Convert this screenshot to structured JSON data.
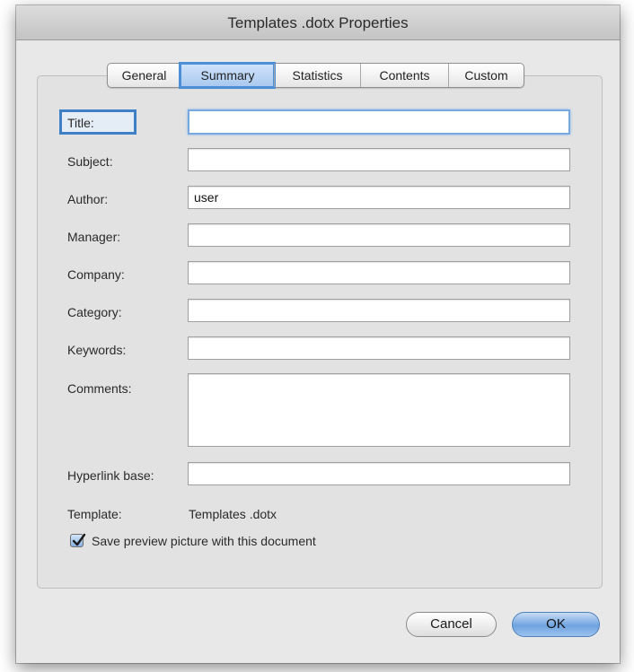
{
  "window": {
    "title": "Templates .dotx Properties"
  },
  "tabs": [
    {
      "label": "General"
    },
    {
      "label": "Summary"
    },
    {
      "label": "Statistics"
    },
    {
      "label": "Contents"
    },
    {
      "label": "Custom"
    }
  ],
  "active_tab": "Summary",
  "fields": {
    "title": {
      "label": "Title:",
      "value": ""
    },
    "subject": {
      "label": "Subject:",
      "value": ""
    },
    "author": {
      "label": "Author:",
      "value": "user"
    },
    "manager": {
      "label": "Manager:",
      "value": ""
    },
    "company": {
      "label": "Company:",
      "value": ""
    },
    "category": {
      "label": "Category:",
      "value": ""
    },
    "keywords": {
      "label": "Keywords:",
      "value": ""
    },
    "comments": {
      "label": "Comments:",
      "value": ""
    },
    "hyperlink_base": {
      "label": "Hyperlink base:",
      "value": ""
    }
  },
  "template": {
    "label": "Template:",
    "value": "Templates .dotx"
  },
  "save_preview": {
    "label": "Save preview picture with this document",
    "checked": true
  },
  "buttons": {
    "cancel": "Cancel",
    "ok": "OK"
  },
  "colors": {
    "accent": "#4d8fd6",
    "focus_ring": "#78a8e0"
  }
}
